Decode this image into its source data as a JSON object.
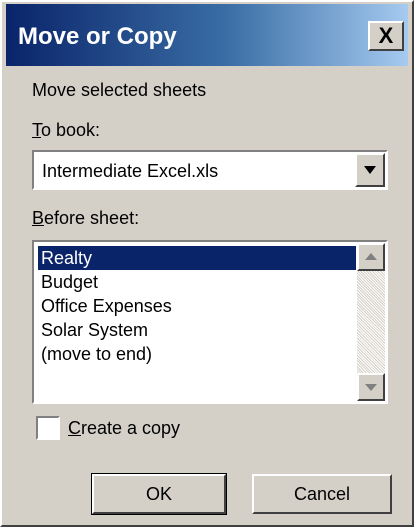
{
  "window": {
    "title": "Move or Copy",
    "close_glyph": "X"
  },
  "dialog": {
    "prompt": "Move selected sheets",
    "to_book": {
      "label_accel": "T",
      "label_rest": "o book:",
      "value": "Intermediate Excel.xls"
    },
    "before_sheet": {
      "label_accel": "B",
      "label_rest": "efore sheet:",
      "items": [
        "Realty",
        "Budget",
        "Office Expenses",
        "Solar System",
        "(move to end)"
      ],
      "selected_index": 0
    },
    "create_copy": {
      "label_accel": "C",
      "label_rest": "reate a copy",
      "checked": false
    },
    "buttons": {
      "ok": "OK",
      "cancel": "Cancel"
    }
  },
  "colors": {
    "face": "#d4d0c8",
    "title_start": "#0a246a",
    "title_end": "#a6caf0",
    "selection": "#0a246a"
  },
  "icons": {
    "close": "close-icon",
    "dropdown": "chevron-down-icon",
    "scroll_up": "scroll-up-arrow-icon",
    "scroll_down": "scroll-down-arrow-icon"
  }
}
